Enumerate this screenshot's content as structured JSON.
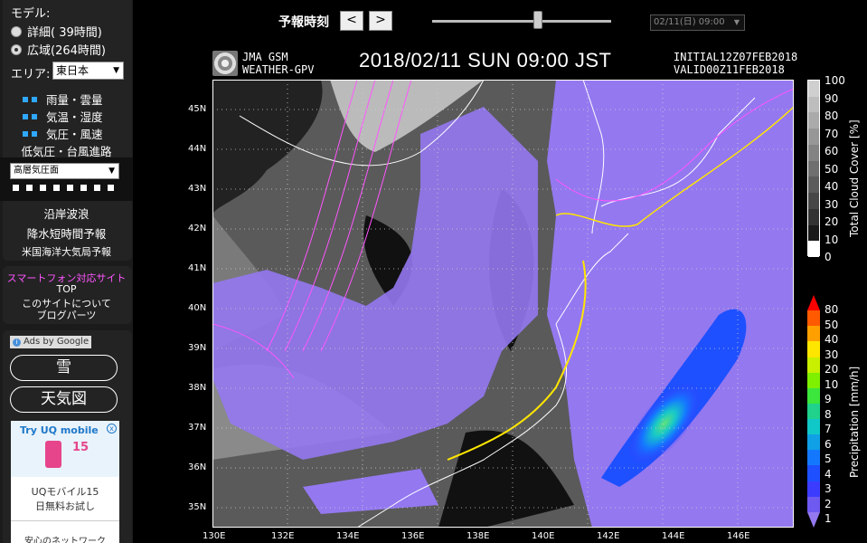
{
  "sidebar": {
    "model_label": "モデル:",
    "model_options": [
      {
        "label": "詳細(  39時間)",
        "checked": false
      },
      {
        "label": "広域(264時間)",
        "checked": true
      }
    ],
    "area_label": "エリア:",
    "area_value": "東日本",
    "layers": [
      "雨量・雲量",
      "気温・湿度",
      "気圧・風速"
    ],
    "typhoon_label": "低気圧・台風進路",
    "level_select": "高層気圧面",
    "links": [
      "沿岸波浪",
      "降水短時間予報",
      "米国海洋大気局予報"
    ],
    "smartphone_label": "スマートフォン対応サイト",
    "top_label": "TOP",
    "about_label": "このサイトについて",
    "blog_label": "ブログパーツ",
    "ads_label": "Ads by Google",
    "ad_buttons": [
      "雪",
      "天気図"
    ],
    "ad_banner": {
      "brand": "Try UQ mobile",
      "number": "15",
      "title": "UQモバイル15",
      "subtitle": "日無料お試し",
      "footer": "安心のネットワーク"
    }
  },
  "header": {
    "forecast_label": "予報時刻",
    "prev_label": "<",
    "next_label": ">",
    "slider_fraction": 0.59,
    "time_select": "02/11(日) 09:00"
  },
  "map_header": {
    "source1": "JMA GSM",
    "source2": "WEATHER-GPV",
    "datetime": "2018/02/11 SUN 09:00 JST",
    "initial": "INITIAL12Z07FEB2018",
    "valid": "VALID00Z11FEB2018"
  },
  "map": {
    "lat_labels": [
      "45N",
      "44N",
      "43N",
      "42N",
      "41N",
      "40N",
      "39N",
      "38N",
      "37N",
      "36N",
      "35N"
    ],
    "lon_labels": [
      "130E",
      "132E",
      "134E",
      "136E",
      "138E",
      "140E",
      "142E",
      "144E",
      "146E"
    ]
  },
  "cloud_legend": {
    "title": "Total Cloud Cover [%]",
    "labels": [
      "100",
      "90",
      "80",
      "70",
      "60",
      "50",
      "40",
      "30",
      "20",
      "10",
      "0"
    ],
    "colors": [
      "#cfcfcf",
      "#bdbdbd",
      "#aaaaaa",
      "#979797",
      "#838383",
      "#6f6f6f",
      "#5b5b5b",
      "#474747",
      "#333333",
      "#1a1a1a",
      "#ffffff"
    ]
  },
  "precip_legend": {
    "title": "Precipitation [mm/h]",
    "labels": [
      "80",
      "50",
      "40",
      "30",
      "20",
      "10",
      "9",
      "8",
      "7",
      "6",
      "5",
      "4",
      "3",
      "2",
      "1"
    ],
    "colors": [
      "#ff0000",
      "#ff5a00",
      "#ffa000",
      "#ffe600",
      "#c8f000",
      "#7ef000",
      "#3ce63c",
      "#20d28c",
      "#10c8c8",
      "#10a0e6",
      "#1478ff",
      "#1e50ff",
      "#3c3cff",
      "#6e5af0",
      "#9478f0"
    ]
  },
  "colors": {
    "accent_blue": "#2fa8ff",
    "link_pink": "#ff55ff",
    "precip_purple": "#9478f0"
  }
}
